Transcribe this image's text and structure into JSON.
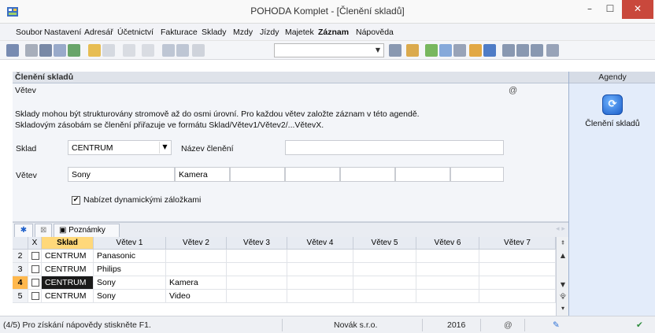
{
  "window": {
    "title": "POHODA Komplet - [Členění skladů]",
    "minimize_glyph": "–",
    "maximize_glyph": "☐",
    "close_glyph": "✕"
  },
  "menu": [
    "Soubor",
    "Nastavení",
    "Adresář",
    "Účetnictví",
    "Fakturace",
    "Sklady",
    "Mzdy",
    "Jízdy",
    "Majetek",
    "Záznam",
    "Nápověda"
  ],
  "menu_bold_index": 9,
  "toolbar": {
    "combo_value": "",
    "icons": [
      "agenda-tree-icon",
      "document-icon",
      "print-icon",
      "preview-icon",
      "export-icon",
      "new-record-icon",
      "edit-icon",
      "back-icon",
      "forward-icon",
      "save-icon",
      "save-all-icon",
      "copy-icon",
      "filter-icon",
      "folder-icon",
      "diamond-icon",
      "calculator-icon",
      "sum-icon",
      "users-icon",
      "bank-icon",
      "window-icon",
      "panel-icon",
      "layout-icon",
      "help-icon"
    ]
  },
  "section": {
    "title": "Členění skladů",
    "subtitle": "Větev",
    "description_line1": "Sklady mohou být strukturovány stromově až do osmi úrovní. Pro každou větev založte záznam v této agendě.",
    "description_line2": "Skladovým zásobám se členění přiřazuje ve formátu Sklad/Větev1/Větev2/...VětevX.",
    "at_icon": "@"
  },
  "form": {
    "sklad_label": "Sklad",
    "sklad_value": "CENTRUM",
    "nazev_label": "Název členění",
    "nazev_value": "",
    "vetev_label": "Větev",
    "vetev_values": [
      "Sony",
      "Kamera",
      "",
      "",
      "",
      "",
      "",
      ""
    ],
    "checkbox_label": "Nabízet dynamickými záložkami",
    "checkbox_checked": true
  },
  "sidebar": {
    "header": "Agendy",
    "item_label": "Členění skladů"
  },
  "tabs": {
    "star": "✱",
    "filter": "⊠",
    "notes": "Poznámky"
  },
  "grid": {
    "headers": [
      "",
      "X",
      "Sklad",
      "Větev 1",
      "Větev 2",
      "Větev 3",
      "Větev 4",
      "Větev 5",
      "Větev 6",
      "Větev 7"
    ],
    "sorted_column": 2,
    "rows": [
      {
        "num": "2",
        "sklad": "CENTRUM",
        "vetve": [
          "Panasonic",
          "",
          "",
          "",
          "",
          "",
          ""
        ],
        "active": false
      },
      {
        "num": "3",
        "sklad": "CENTRUM",
        "vetve": [
          "Philips",
          "",
          "",
          "",
          "",
          "",
          ""
        ],
        "active": false
      },
      {
        "num": "4",
        "sklad": "CENTRUM",
        "vetve": [
          "Sony",
          "Kamera",
          "",
          "",
          "",
          "",
          ""
        ],
        "active": true
      },
      {
        "num": "5",
        "sklad": "CENTRUM",
        "vetve": [
          "Sony",
          "Video",
          "",
          "",
          "",
          "",
          ""
        ],
        "active": false
      }
    ]
  },
  "status": {
    "hint": "(4/5) Pro získání nápovědy stiskněte F1.",
    "company": "Novák s.r.o.",
    "year": "2016"
  },
  "colors": {
    "accent": "#1c5ec9",
    "active_row": "#ffb84d",
    "sorted_header": "#ffd87a",
    "close_button": "#c9483c"
  }
}
